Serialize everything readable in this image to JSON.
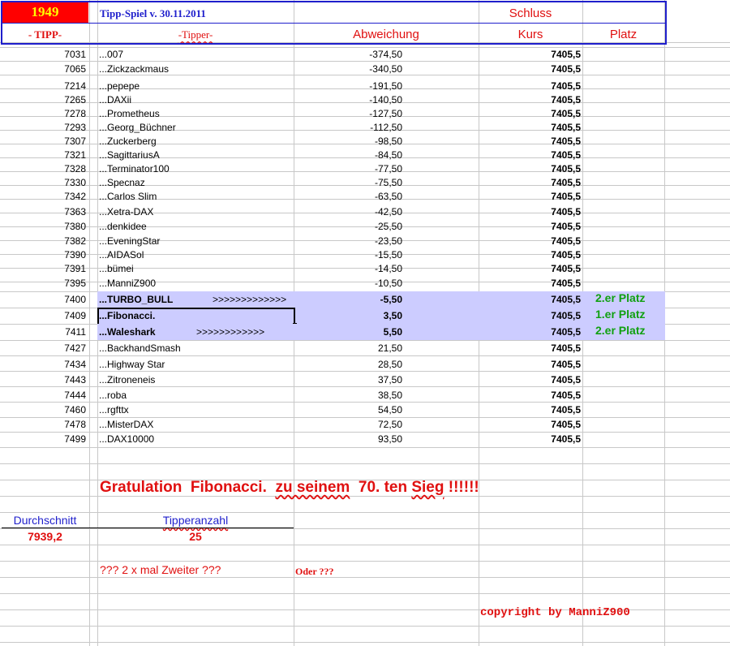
{
  "header": {
    "number": "1949",
    "game_title": "Tipp-Spiel v. 30.11.2011",
    "schluss": "Schluss",
    "col_tipp": "- TIPP-",
    "col_tipper": "-Tipper-",
    "col_abweichung": "Abweichung",
    "col_kurs": "Kurs",
    "col_platz": "Platz"
  },
  "colors": {
    "header_red": "#ff0000",
    "header_yellow": "#ffff00",
    "header_border": "#1f1fcc",
    "highlight": "#ccccff",
    "title_text": "#1f1fcc"
  },
  "rows": [
    {
      "tipp": "7031",
      "name": "...007",
      "dev": "-374,50",
      "kurs": "7405,5",
      "platz": ""
    },
    {
      "tipp": "7065",
      "name": "...Zickzackmaus",
      "dev": "-340,50",
      "kurs": "7405,5",
      "platz": ""
    },
    {
      "tipp": "7214",
      "name": "...pepepe",
      "dev": "-191,50",
      "kurs": "7405,5",
      "platz": ""
    },
    {
      "tipp": "7265",
      "name": "...DAXii",
      "dev": "-140,50",
      "kurs": "7405,5",
      "platz": ""
    },
    {
      "tipp": "7278",
      "name": "...Prometheus",
      "dev": "-127,50",
      "kurs": "7405,5",
      "platz": ""
    },
    {
      "tipp": "7293",
      "name": "...Georg_Büchner",
      "dev": "-112,50",
      "kurs": "7405,5",
      "platz": ""
    },
    {
      "tipp": "7307",
      "name": "...Zuckerberg",
      "dev": "-98,50",
      "kurs": "7405,5",
      "platz": ""
    },
    {
      "tipp": "7321",
      "name": "...SagittariusA",
      "dev": "-84,50",
      "kurs": "7405,5",
      "platz": ""
    },
    {
      "tipp": "7328",
      "name": "...Terminator100",
      "dev": "-77,50",
      "kurs": "7405,5",
      "platz": ""
    },
    {
      "tipp": "7330",
      "name": "...Specnaz",
      "dev": "-75,50",
      "kurs": "7405,5",
      "platz": ""
    },
    {
      "tipp": "7342",
      "name": "...Carlos Slim",
      "dev": "-63,50",
      "kurs": "7405,5",
      "platz": ""
    },
    {
      "tipp": "7363",
      "name": "...Xetra-DAX",
      "dev": "-42,50",
      "kurs": "7405,5",
      "platz": ""
    },
    {
      "tipp": "7380",
      "name": "...denkidee",
      "dev": "-25,50",
      "kurs": "7405,5",
      "platz": ""
    },
    {
      "tipp": "7382",
      "name": "...EveningStar",
      "dev": "-23,50",
      "kurs": "7405,5",
      "platz": ""
    },
    {
      "tipp": "7390",
      "name": "...AIDASol",
      "dev": "-15,50",
      "kurs": "7405,5",
      "platz": ""
    },
    {
      "tipp": "7391",
      "name": "...bümei",
      "dev": "-14,50",
      "kurs": "7405,5",
      "platz": ""
    },
    {
      "tipp": "7395",
      "name": "...ManniZ900",
      "dev": "-10,50",
      "kurs": "7405,5",
      "platz": ""
    },
    {
      "tipp": "7400",
      "name": "...TURBO_BULL",
      "arrows": ">>>>>>>>>>>>>",
      "dev": "-5,50",
      "kurs": "7405,5",
      "platz": "2.er Platz",
      "highlight": true
    },
    {
      "tipp": "7409",
      "name": "...Fibonacci.",
      "arrows": "",
      "dev": "3,50",
      "kurs": "7405,5",
      "platz": "1.er Platz",
      "highlight": true,
      "selected": true
    },
    {
      "tipp": "7411",
      "name": "...Waleshark",
      "arrows": ">>>>>>>>>>>>",
      "dev": "5,50",
      "kurs": "7405,5",
      "platz": "2.er Platz",
      "highlight": true
    },
    {
      "tipp": "7427",
      "name": "...BackhandSmash",
      "dev": "21,50",
      "kurs": "7405,5",
      "platz": ""
    },
    {
      "tipp": "7434",
      "name": "...Highway Star",
      "dev": "28,50",
      "kurs": "7405,5",
      "platz": ""
    },
    {
      "tipp": "7443",
      "name": "...Zitroneneis",
      "dev": "37,50",
      "kurs": "7405,5",
      "platz": ""
    },
    {
      "tipp": "7444",
      "name": "...roba",
      "dev": "38,50",
      "kurs": "7405,5",
      "platz": ""
    },
    {
      "tipp": "7460",
      "name": "...rgfttx",
      "dev": "54,50",
      "kurs": "7405,5",
      "platz": ""
    },
    {
      "tipp": "7478",
      "name": "...MisterDAX",
      "dev": "72,50",
      "kurs": "7405,5",
      "platz": ""
    },
    {
      "tipp": "7499",
      "name": "...DAX10000",
      "dev": "93,50",
      "kurs": "7405,5",
      "platz": ""
    }
  ],
  "congrats": {
    "w1": "Gratulation",
    "w2": "Fibonacci.",
    "w3": "zu seinem",
    "w4": "70. ten",
    "w5": "Sieg",
    "w6": "!!!!!!"
  },
  "stats": {
    "avg_label": "Durchschnitt",
    "avg_value": "7939,2",
    "count_label": "Tipperanzahl",
    "count_value": "25"
  },
  "notes": {
    "question": "??? 2 x mal Zweiter ???",
    "oder": "Oder ???",
    "copyright": "copyright by ManniZ900"
  }
}
